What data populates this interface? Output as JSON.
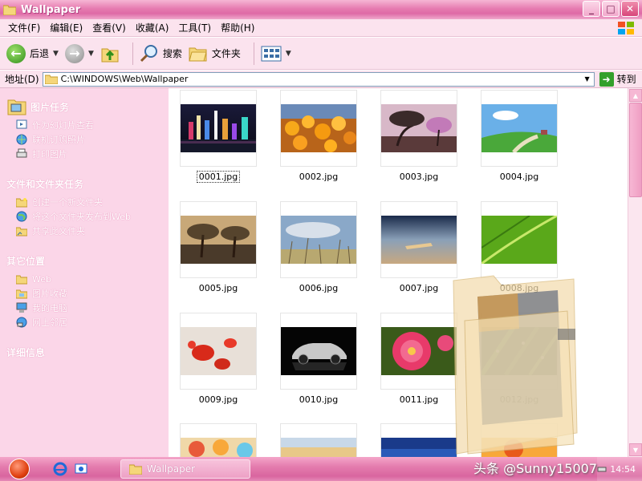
{
  "window": {
    "title": "Wallpaper",
    "buttons": [
      "minimize",
      "maximize",
      "close"
    ]
  },
  "menu": {
    "items": [
      "文件(F)",
      "编辑(E)",
      "查看(V)",
      "收藏(A)",
      "工具(T)",
      "帮助(H)"
    ]
  },
  "toolbar": {
    "back_label": "后退",
    "search_label": "搜索",
    "folders_label": "文件夹",
    "icons": [
      "back-arrow-icon",
      "forward-arrow-icon",
      "up-folder-icon",
      "search-icon",
      "folders-icon",
      "views-icon"
    ]
  },
  "address": {
    "label": "地址(D)",
    "path": "C:\\WINDOWS\\Web\\Wallpaper",
    "go_label": "转到"
  },
  "taskpane": {
    "sections": [
      {
        "title": "图片任务",
        "items": [
          "作为幻灯片查看",
          "联机订购照片",
          "打印图片"
        ]
      },
      {
        "title": "文件和文件夹任务",
        "items": [
          "创建一个新文件夹",
          "将这个文件夹发布到Web",
          "共享此文件夹"
        ]
      },
      {
        "title": "其它位置",
        "items": [
          "Web",
          "图片收藏",
          "我的电脑",
          "网上邻居"
        ]
      },
      {
        "title": "详细信息",
        "items": []
      }
    ]
  },
  "files": [
    {
      "name": "0001.jpg",
      "theme": "city-night"
    },
    {
      "name": "0002.jpg",
      "theme": "orange-flowers"
    },
    {
      "name": "0003.jpg",
      "theme": "blossom-tree"
    },
    {
      "name": "0004.jpg",
      "theme": "green-hill"
    },
    {
      "name": "0005.jpg",
      "theme": "tree-sunset"
    },
    {
      "name": "0006.jpg",
      "theme": "grass-sky"
    },
    {
      "name": "0007.jpg",
      "theme": "beach-blur"
    },
    {
      "name": "0008.jpg",
      "theme": "green-leaf"
    },
    {
      "name": "0009.jpg",
      "theme": "red-crabs"
    },
    {
      "name": "0010.jpg",
      "theme": "silver-car"
    },
    {
      "name": "0011.jpg",
      "theme": "pink-flower"
    },
    {
      "name": "0012.jpg",
      "theme": "dewy-leaf"
    },
    {
      "name": "",
      "theme": "partial-colorful"
    },
    {
      "name": "",
      "theme": "partial-wheat"
    },
    {
      "name": "",
      "theme": "partial-blue"
    },
    {
      "name": "",
      "theme": "partial-orange"
    }
  ],
  "selected_file": "0001.jpg",
  "taskbar": {
    "window_button": "Wallpaper",
    "clock": "14:54"
  },
  "watermark": "头条 @Sunny15007"
}
